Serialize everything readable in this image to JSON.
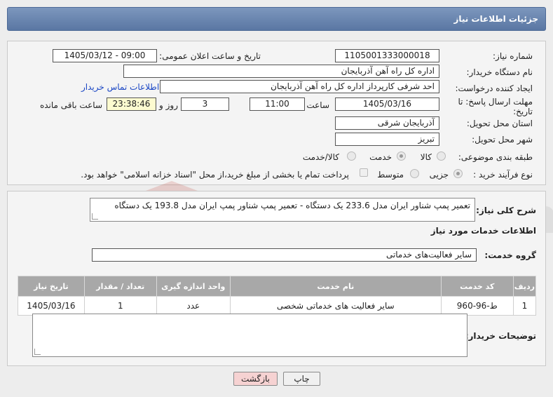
{
  "header": {
    "title": "جزئیات اطلاعات نیاز"
  },
  "form": {
    "need_number_label": "شماره نیاز:",
    "need_number": "1105001333000018",
    "announce_label": "تاریخ و ساعت اعلان عمومی:",
    "announce_value": "1405/03/12 - 09:00",
    "buyer_org_label": "نام دستگاه خریدار:",
    "buyer_org": "اداره کل راه آهن آذربایجان",
    "creator_label": "ایجاد کننده درخواست:",
    "creator": "احد شرفی کارپرداز اداره کل راه آهن آذربایجان",
    "contact_link": "اطلاعات تماس خریدار",
    "deadline_label_1": "مهلت ارسال پاسخ: تا",
    "deadline_label_2": "تاریخ:",
    "deadline_date": "1405/03/16",
    "time_label": "ساعت",
    "deadline_time": "11:00",
    "days_value": "3",
    "days_label": "روز و",
    "remaining_time": "23:38:46",
    "remaining_label": "ساعت باقی مانده",
    "province_label": "استان محل تحویل:",
    "province": "آذربایجان شرقی",
    "city_label": "شهر محل تحویل:",
    "city": "تبریز",
    "category_label": "طبقه بندی موضوعی:",
    "category_options": [
      "کالا",
      "خدمت",
      "کالا/خدمت"
    ],
    "process_label": "نوع فرآیند خرید :",
    "process_options": [
      "جزیی",
      "متوسط"
    ],
    "payment_note": "پرداخت تمام یا بخشی از مبلغ خرید،از محل \"اسناد خزانه اسلامی\" خواهد بود."
  },
  "details": {
    "summary_label": "شرح کلی نیاز:",
    "summary": "تعمیر پمپ شناور ایران مدل 233.6 یک دستگاه - تعمیر پمپ شناور پمپ ایران مدل 193.8 یک دستگاه",
    "services_heading": "اطلاعات خدمات مورد نیاز",
    "service_group_label": "گروه خدمت:",
    "service_group": "سایر فعالیت‌های خدماتی",
    "table": {
      "headers": [
        "ردیف",
        "کد خدمت",
        "نام خدمت",
        "واحد اندازه گیری",
        "تعداد / مقدار",
        "تاریخ نیاز"
      ],
      "rows": [
        [
          "1",
          "ط-96-960",
          "سایر فعالیت های خدماتی شخصی",
          "عدد",
          "1",
          "1405/03/16"
        ]
      ]
    },
    "buyer_notes_label": "توضیحات خریدار:",
    "buyer_notes": ""
  },
  "watermark": {
    "text": "AriaTender.net"
  },
  "buttons": {
    "print": "چاپ",
    "back": "بازگشت"
  },
  "colors": {
    "header_bg": "#6a86b0",
    "link": "#1a46c4",
    "back_button_bg": "#f6d2d2",
    "highlight_bg": "#fdfbd0"
  }
}
